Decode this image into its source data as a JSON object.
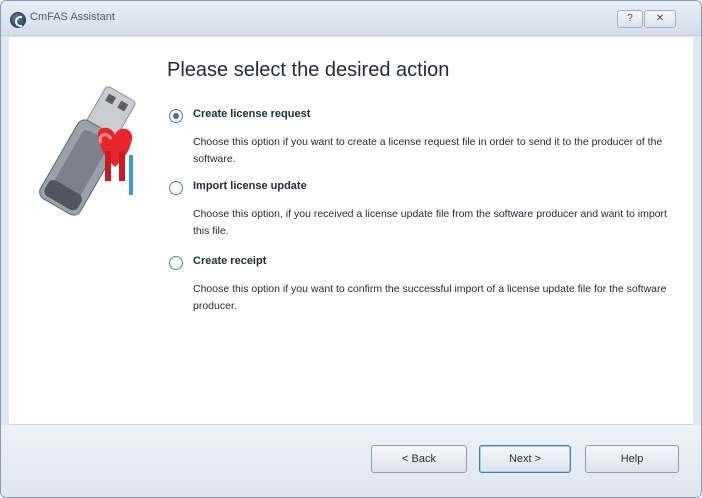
{
  "window": {
    "title": "CmFAS Assistant",
    "help_button": "?",
    "close_button": "✕"
  },
  "main": {
    "heading": "Please select the desired action",
    "options": [
      {
        "label": "Create license request",
        "description": "Choose this option if you want to create a license request file in order to send it to the producer of the software.",
        "selected": true
      },
      {
        "label": "Import license update",
        "description": "Choose this option, if you received a license update file from the software producer and want to import this file.",
        "selected": false
      },
      {
        "label": "Create receipt",
        "description": "Choose this option if you want to confirm the successful import of a license update file for the software producer.",
        "selected": false
      }
    ]
  },
  "footer": {
    "back_label": "< Back",
    "next_label": "Next >",
    "help_label": "Help"
  }
}
